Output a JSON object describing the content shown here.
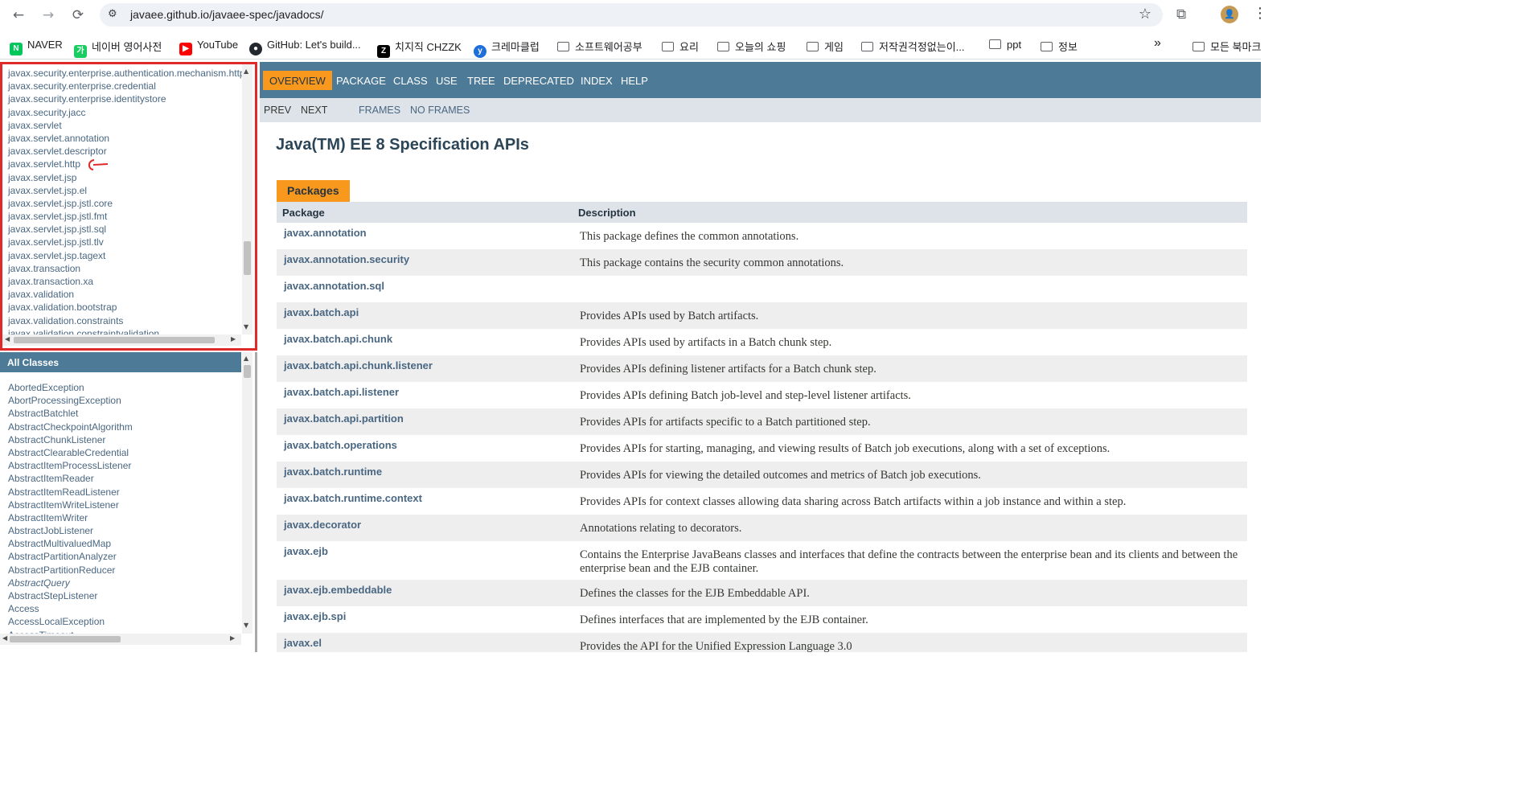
{
  "browser": {
    "url": "javaee.github.io/javaee-spec/javadocs/",
    "back": "←",
    "forward": "→",
    "reload": "⟳",
    "star": "☆",
    "menu": "⋮",
    "overflow": "»",
    "avatar_text": "👤"
  },
  "bookmarks": [
    {
      "label": "NAVER",
      "icon": "N",
      "color": "#03c75a",
      "folder": false
    },
    {
      "label": "네이버 영어사전",
      "icon": "가",
      "color": "#19ce60",
      "folder": false
    },
    {
      "label": "YouTube",
      "icon": "▶",
      "color": "#ff0000",
      "folder": false
    },
    {
      "label": "GitHub: Let's build...",
      "icon": "●",
      "color": "#24292f",
      "folder": false
    },
    {
      "label": "치지직 CHZZK",
      "icon": "Z",
      "color": "#000000",
      "folder": false
    },
    {
      "label": "크레마클럽",
      "icon": "y",
      "color": "#1e6fd9",
      "folder": false
    },
    {
      "label": "소프트웨어공부",
      "folder": true
    },
    {
      "label": "요리",
      "folder": true
    },
    {
      "label": "오늘의 쇼핑",
      "folder": true
    },
    {
      "label": "게임",
      "folder": true
    },
    {
      "label": "저작권걱정없는이...",
      "folder": true
    },
    {
      "label": "ppt",
      "folder": true
    },
    {
      "label": "정보",
      "folder": true
    },
    {
      "label": "모든 북마크",
      "folder": true
    }
  ],
  "packages_frame": {
    "items": [
      "javax.security.enterprise.authentication.mechanism.http",
      "javax.security.enterprise.credential",
      "javax.security.enterprise.identitystore",
      "javax.security.jacc",
      "javax.servlet",
      "javax.servlet.annotation",
      "javax.servlet.descriptor",
      "javax.servlet.http",
      "javax.servlet.jsp",
      "javax.servlet.jsp.el",
      "javax.servlet.jsp.jstl.core",
      "javax.servlet.jsp.jstl.fmt",
      "javax.servlet.jsp.jstl.sql",
      "javax.servlet.jsp.jstl.tlv",
      "javax.servlet.jsp.tagext",
      "javax.transaction",
      "javax.transaction.xa",
      "javax.validation",
      "javax.validation.bootstrap",
      "javax.validation.constraints",
      "javax.validation.constraintvalidation"
    ],
    "annotation_color": "#e02929"
  },
  "classes_frame": {
    "header": "All Classes",
    "items": [
      {
        "name": "AbortedException",
        "italic": false
      },
      {
        "name": "AbortProcessingException",
        "italic": false
      },
      {
        "name": "AbstractBatchlet",
        "italic": false
      },
      {
        "name": "AbstractCheckpointAlgorithm",
        "italic": false
      },
      {
        "name": "AbstractChunkListener",
        "italic": false
      },
      {
        "name": "AbstractClearableCredential",
        "italic": false
      },
      {
        "name": "AbstractItemProcessListener",
        "italic": false
      },
      {
        "name": "AbstractItemReader",
        "italic": false
      },
      {
        "name": "AbstractItemReadListener",
        "italic": false
      },
      {
        "name": "AbstractItemWriteListener",
        "italic": false
      },
      {
        "name": "AbstractItemWriter",
        "italic": false
      },
      {
        "name": "AbstractJobListener",
        "italic": false
      },
      {
        "name": "AbstractMultivaluedMap",
        "italic": false
      },
      {
        "name": "AbstractPartitionAnalyzer",
        "italic": false
      },
      {
        "name": "AbstractPartitionReducer",
        "italic": false
      },
      {
        "name": "AbstractQuery",
        "italic": true
      },
      {
        "name": "AbstractStepListener",
        "italic": false
      },
      {
        "name": "Access",
        "italic": false
      },
      {
        "name": "AccessLocalException",
        "italic": false
      },
      {
        "name": "AccessTimeout",
        "italic": false
      }
    ]
  },
  "content": {
    "topnav": [
      "OVERVIEW",
      "PACKAGE",
      "CLASS",
      "USE",
      "TREE",
      "DEPRECATED",
      "INDEX",
      "HELP"
    ],
    "active_tab": "OVERVIEW",
    "subnav": {
      "prev": "PREV",
      "next": "NEXT",
      "frames": "FRAMES",
      "no_frames": "NO FRAMES"
    },
    "title": "Java(TM) EE 8 Specification APIs",
    "table_caption": "Packages",
    "columns": {
      "package": "Package",
      "description": "Description"
    },
    "rows": [
      {
        "package": "javax.annotation",
        "description": "This package defines the common annotations."
      },
      {
        "package": "javax.annotation.security",
        "description": "This package contains the security common annotations."
      },
      {
        "package": "javax.annotation.sql",
        "description": ""
      },
      {
        "package": "javax.batch.api",
        "description": "Provides APIs used by Batch artifacts."
      },
      {
        "package": "javax.batch.api.chunk",
        "description": "Provides APIs used by artifacts in a Batch chunk step."
      },
      {
        "package": "javax.batch.api.chunk.listener",
        "description": "Provides APIs defining listener artifacts for a Batch chunk step."
      },
      {
        "package": "javax.batch.api.listener",
        "description": "Provides APIs defining Batch job-level and step-level listener artifacts."
      },
      {
        "package": "javax.batch.api.partition",
        "description": "Provides APIs for artifacts specific to a Batch partitioned step."
      },
      {
        "package": "javax.batch.operations",
        "description": "Provides APIs for starting, managing, and viewing results of Batch job executions, along with a set of exceptions."
      },
      {
        "package": "javax.batch.runtime",
        "description": "Provides APIs for viewing the detailed outcomes and metrics of Batch job executions."
      },
      {
        "package": "javax.batch.runtime.context",
        "description": "Provides APIs for context classes allowing data sharing across Batch artifacts within a job instance and within a step."
      },
      {
        "package": "javax.decorator",
        "description": "Annotations relating to decorators."
      },
      {
        "package": "javax.ejb",
        "description": "Contains the Enterprise JavaBeans classes and interfaces that define the contracts between the enterprise bean and its clients and between the enterprise bean and the EJB container."
      },
      {
        "package": "javax.ejb.embeddable",
        "description": "Defines the classes for the EJB Embeddable API."
      },
      {
        "package": "javax.ejb.spi",
        "description": "Defines interfaces that are implemented by the EJB container."
      },
      {
        "package": "javax.el",
        "description": "Provides the API for the Unified Expression Language 3.0"
      }
    ]
  },
  "colors": {
    "nav_blue": "#4d7a97",
    "accent_orange": "#f8981d",
    "link_blue": "#4a6782",
    "header_gray": "#dee3e9",
    "highlight_red": "#e02929"
  }
}
